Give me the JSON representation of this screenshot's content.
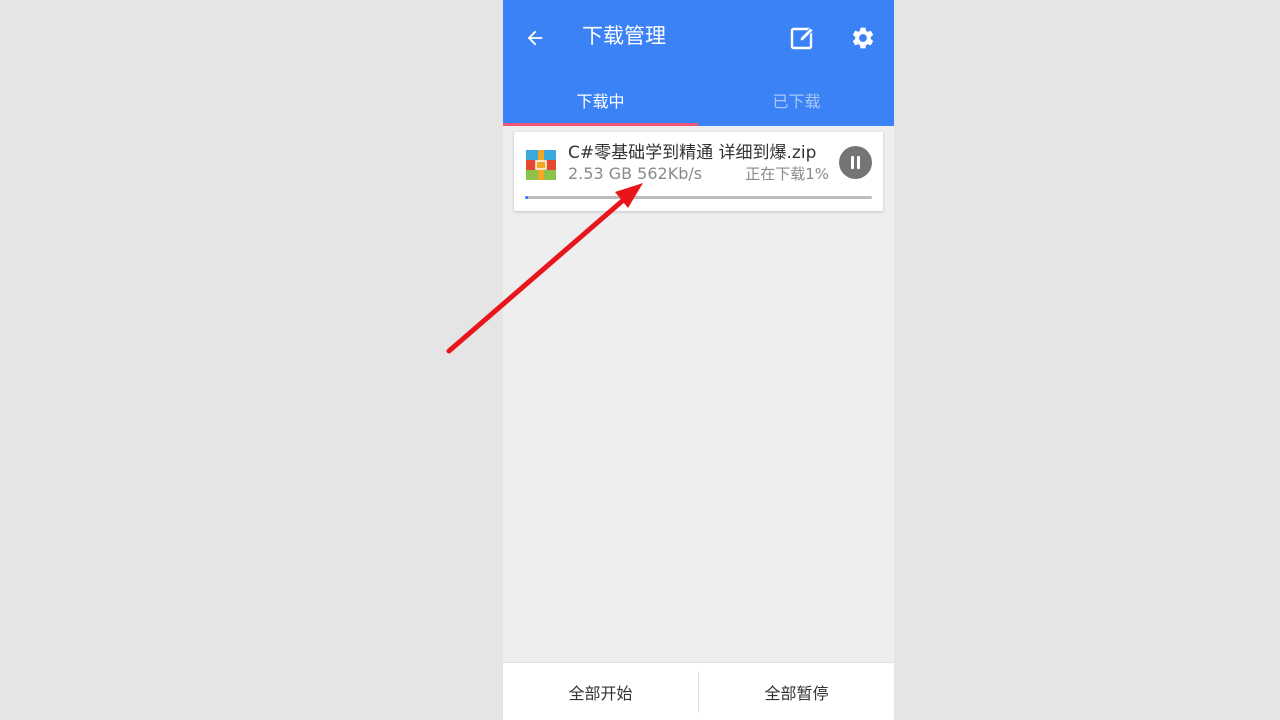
{
  "header": {
    "title": "下载管理",
    "back_icon": "arrow-left-icon",
    "edit_icon": "edit-icon",
    "settings_icon": "gear-icon",
    "accent_color": "#3b82f6"
  },
  "tabs": [
    {
      "label": "下载中",
      "active": true
    },
    {
      "label": "已下载",
      "active": false
    }
  ],
  "downloads": [
    {
      "file_name": "C#零基础学到精通 详细到爆.zip",
      "size": "2.53 GB",
      "speed": "562Kb/s",
      "meta": "2.53 GB 562Kb/s",
      "status": "正在下载1%",
      "progress_percent": 1,
      "icon": "archive-file-icon",
      "action_icon": "pause-icon"
    }
  ],
  "bottom_bar": {
    "start_all_label": "全部开始",
    "pause_all_label": "全部暂停"
  },
  "annotation": {
    "type": "red-arrow",
    "color": "#e8151b"
  }
}
